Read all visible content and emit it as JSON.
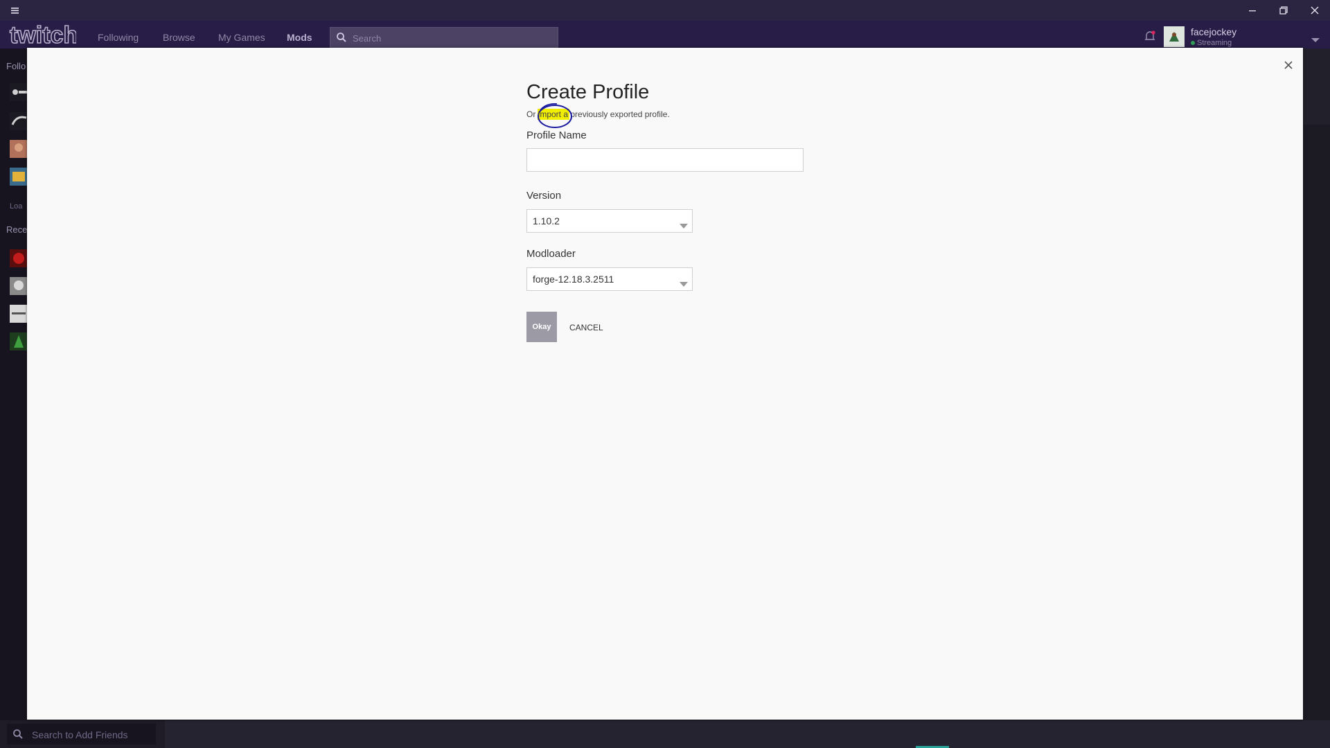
{
  "nav": {
    "links": [
      "Following",
      "Browse",
      "My Games",
      "Mods"
    ],
    "search_placeholder": "Search"
  },
  "user": {
    "name": "facejockey",
    "status": "Streaming"
  },
  "sidebar": {
    "following_label": "Follo",
    "loading_label": "Loa",
    "recent_label": "Rece"
  },
  "friends": {
    "search_placeholder": "Search to Add Friends"
  },
  "modal": {
    "title": "Create Profile",
    "subtitle_prefix": "Or ",
    "import_link": "import a",
    "subtitle_suffix": " previously exported profile.",
    "profile_name_label": "Profile Name",
    "profile_name_value": "",
    "version_label": "Version",
    "version_value": "1.10.2",
    "modloader_label": "Modloader",
    "modloader_value": "forge-12.18.3.2511",
    "okay_label": "Okay",
    "cancel_label": "CANCEL"
  },
  "colors": {
    "titlebar": "#2c2541",
    "navbar": "#281d46",
    "highlight": "#f2ee00",
    "annotation": "#1a1aa0",
    "okay_button": "#9c9aa5"
  }
}
